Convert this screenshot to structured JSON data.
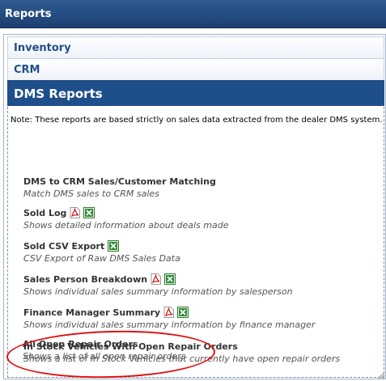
{
  "window": {
    "title": "Reports"
  },
  "sections": {
    "inventory": "Inventory",
    "crm": "CRM",
    "dms": "DMS Reports"
  },
  "note": "Note: These reports are based strictly on sales data extracted from the dealer DMS system.",
  "reports": [
    {
      "name": "DMS to CRM Sales/Customer Matching",
      "desc": "Match DMS sales to CRM sales",
      "pdf": false,
      "excel": false
    },
    {
      "name": "Sold Log",
      "desc": "Shows detailed information about deals made",
      "pdf": true,
      "excel": true
    },
    {
      "name": "Sold CSV Export",
      "desc": "CSV Export of Raw DMS Sales Data",
      "pdf": false,
      "excel": true
    },
    {
      "name": "Sales Person Breakdown",
      "desc": "Shows individual sales summary information by salesperson",
      "pdf": true,
      "excel": true
    },
    {
      "name": "Finance Manager Summary",
      "desc": "Shows individual sales summary information by finance manager",
      "pdf": true,
      "excel": true
    },
    {
      "name": "In Stock Vehicles With Open Repair Orders",
      "desc": "Shows a list of In Stock Vehicles that currently have open repair orders",
      "pdf": false,
      "excel": false
    },
    {
      "name": "All Open Repair Orders",
      "desc": "Shows a list of all open repair orders",
      "pdf": false,
      "excel": false
    }
  ],
  "colors": {
    "titlebar": "#1f4f8a",
    "link": "#1f4f8a",
    "annotation": "#e01010"
  }
}
